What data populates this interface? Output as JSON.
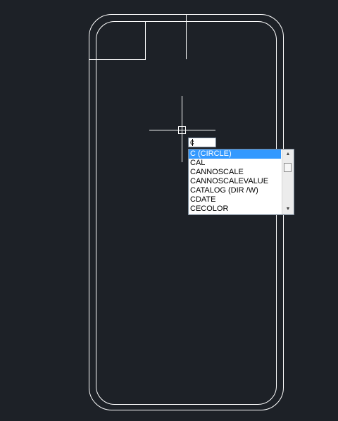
{
  "command_line": {
    "value": "c"
  },
  "autocomplete": {
    "items": [
      {
        "label": "C (CIRCLE)",
        "selected": true
      },
      {
        "label": "CAL",
        "selected": false
      },
      {
        "label": "CANNOSCALE",
        "selected": false
      },
      {
        "label": "CANNOSCALEVALUE",
        "selected": false
      },
      {
        "label": "CATALOG (DIR /W)",
        "selected": false
      },
      {
        "label": "CDATE",
        "selected": false
      },
      {
        "label": "CECOLOR",
        "selected": false
      }
    ],
    "scroll_up_icon": "triangle-up",
    "scroll_down_icon": "triangle-down",
    "selected_color": "#3399ff"
  },
  "theme": {
    "canvas_background": "#1d2127",
    "line_color": "#ffffff"
  }
}
